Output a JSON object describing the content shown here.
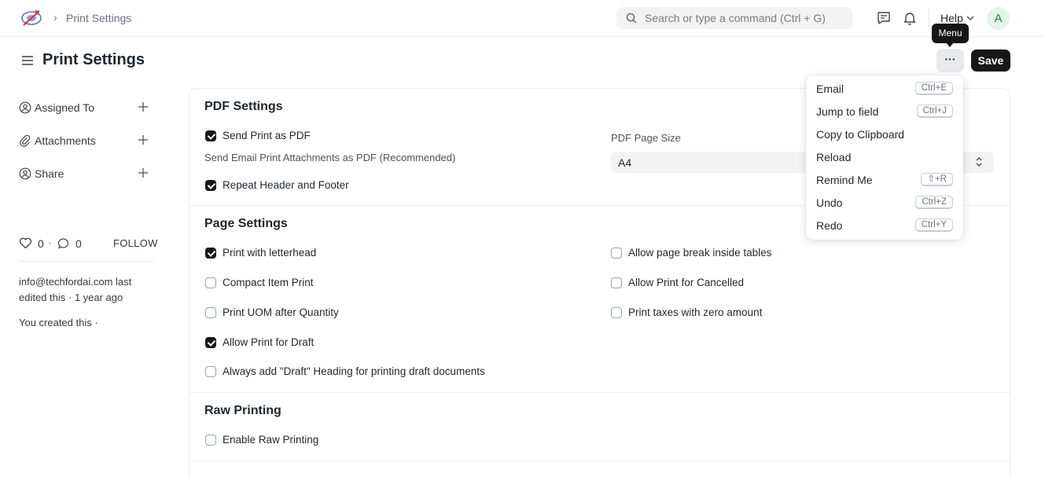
{
  "navbar": {
    "breadcrumb": "Print Settings",
    "breadcrumb_sep": "›",
    "search_placeholder": "Search or type a command (Ctrl + G)",
    "help_label": "Help",
    "avatar_initial": "A"
  },
  "page": {
    "title": "Print Settings",
    "menu_button": "···",
    "save_button": "Save",
    "tooltip": "Menu"
  },
  "sidebar": {
    "assigned_to": "Assigned To",
    "attachments": "Attachments",
    "share": "Share",
    "likes_count": "0",
    "separator": "·",
    "comments_count": "0",
    "follow": "FOLLOW",
    "activity_edited": "info@techfordai.com last edited this · 1 year ago",
    "activity_created": "You created this ·"
  },
  "pdf_settings": {
    "title": "PDF Settings",
    "send_print_as_pdf": {
      "label": "Send Print as PDF",
      "checked": true
    },
    "send_print_desc": "Send Email Print Attachments as PDF (Recommended)",
    "repeat_header_footer": {
      "label": "Repeat Header and Footer",
      "checked": true
    },
    "pdf_page_size_label": "PDF Page Size",
    "pdf_page_size_value": "A4"
  },
  "page_settings": {
    "title": "Page Settings",
    "left": [
      {
        "label": "Print with letterhead",
        "checked": true
      },
      {
        "label": "Compact Item Print",
        "checked": false
      },
      {
        "label": "Print UOM after Quantity",
        "checked": false
      },
      {
        "label": "Allow Print for Draft",
        "checked": true
      },
      {
        "label": "Always add \"Draft\" Heading for printing draft documents",
        "checked": false
      }
    ],
    "right": [
      {
        "label": "Allow page break inside tables",
        "checked": false
      },
      {
        "label": "Allow Print for Cancelled",
        "checked": false
      },
      {
        "label": "Print taxes with zero amount",
        "checked": false
      }
    ]
  },
  "raw_printing": {
    "title": "Raw Printing",
    "enable_raw_printing": {
      "label": "Enable Raw Printing",
      "checked": false
    }
  },
  "menu": {
    "items": [
      {
        "label": "Email",
        "shortcut": "Ctrl+E"
      },
      {
        "label": "Jump to field",
        "shortcut": "Ctrl+J"
      },
      {
        "label": "Copy to Clipboard",
        "shortcut": ""
      },
      {
        "label": "Reload",
        "shortcut": ""
      },
      {
        "label": "Remind Me",
        "shortcut": "⇧+R"
      },
      {
        "label": "Undo",
        "shortcut": "Ctrl+Z"
      },
      {
        "label": "Redo",
        "shortcut": "Ctrl+Y"
      }
    ]
  },
  "colors": {
    "primary": "#171717",
    "border": "#ebeef0",
    "input_bg": "#f3f3f3",
    "avatar_bg": "#e3f4e8"
  }
}
